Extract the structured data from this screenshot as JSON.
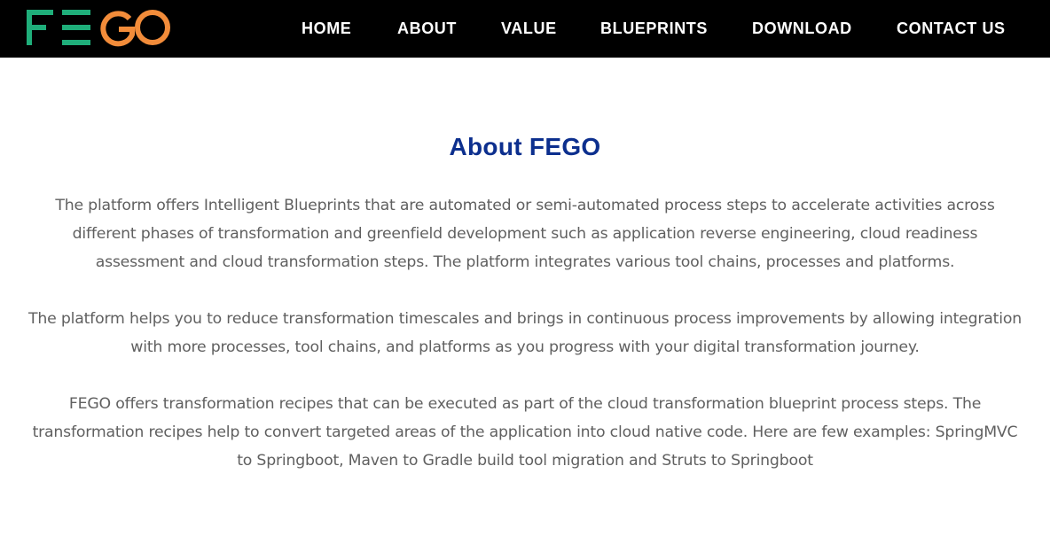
{
  "brand": {
    "logo_text": "FEGO",
    "colors": {
      "fe": "#1fae7a",
      "go": "#f28c3a"
    }
  },
  "nav": {
    "items": [
      {
        "label": "HOME"
      },
      {
        "label": "ABOUT"
      },
      {
        "label": "VALUE"
      },
      {
        "label": "BLUEPRINTS"
      },
      {
        "label": "DOWNLOAD"
      },
      {
        "label": "CONTACT US"
      }
    ]
  },
  "colors": {
    "nav_background": "#000000",
    "title": "#0c2f8e",
    "body_text": "#606060"
  },
  "main": {
    "title": "About FEGO",
    "paragraphs": [
      "The platform offers Intelligent Blueprints that are automated or semi-automated process steps to accelerate activities across different phases of transformation and greenfield development such as application reverse engineering, cloud readiness assessment and cloud transformation steps. The platform integrates various tool chains, processes and platforms.",
      "The platform helps you to reduce transformation timescales and brings in continuous process improvements by allowing integration with more processes, tool chains, and platforms as you progress with your digital transformation journey.",
      "FEGO offers transformation recipes that can be executed as part of the cloud transformation blueprint process steps. The transformation recipes help to convert targeted areas of the application into cloud native code. Here are few examples: SpringMVC to Springboot, Maven to Gradle build tool migration and Struts to Springboot"
    ]
  }
}
